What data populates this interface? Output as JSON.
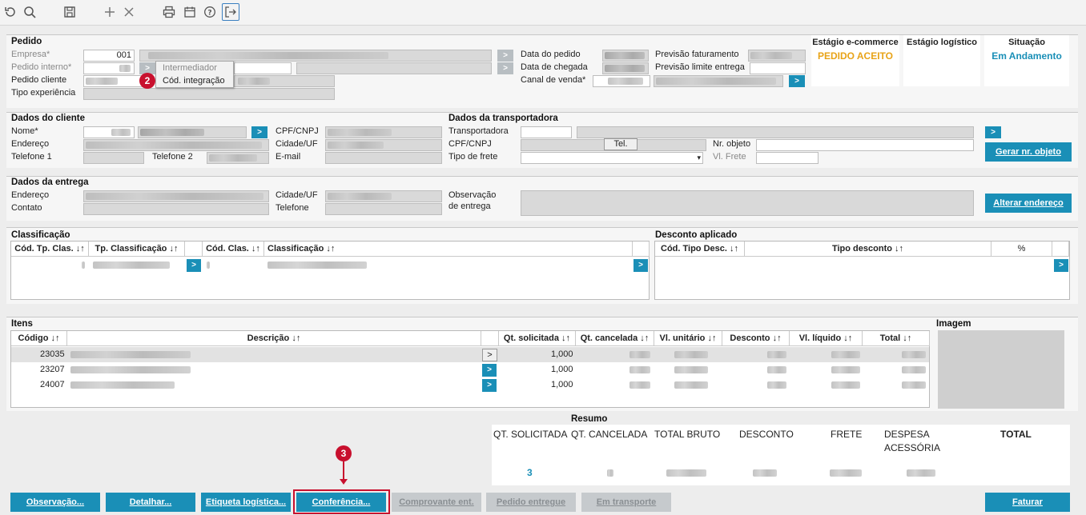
{
  "toolbar": {
    "icons": [
      "refresh-icon",
      "search-icon",
      "save-icon",
      "add-icon",
      "close-icon",
      "print-icon",
      "calendar-icon",
      "help-icon",
      "exit-icon"
    ]
  },
  "pedido": {
    "section_title": "Pedido",
    "empresa_label": "Empresa*",
    "empresa_value": "001",
    "pedido_interno_label": "Pedido interno*",
    "pedido_cliente_label": "Pedido cliente",
    "tipo_experiencia_label": "Tipo experiência",
    "data_pedido_label": "Data do pedido",
    "data_chegada_label": "Data de chegada",
    "canal_venda_label": "Canal de venda*",
    "previsao_faturamento_label": "Previsão faturamento",
    "previsao_limite_label": "Previsão limite entrega",
    "popup_items": [
      "Intermediador",
      "Cód. integração"
    ],
    "arrow_symbol": ">"
  },
  "stages": {
    "ecommerce_title": "Estágio e-commerce",
    "ecommerce_value": "PEDIDO ACEITO",
    "logistico_title": "Estágio logístico",
    "situacao_title": "Situação",
    "situacao_value": "Em Andamento",
    "ecommerce_color": "#e8a317",
    "situacao_color": "#1a8fb7"
  },
  "cliente": {
    "section_title": "Dados do cliente",
    "nome_label": "Nome*",
    "endereco_label": "Endereço",
    "telefone1_label": "Telefone 1",
    "telefone2_label": "Telefone 2",
    "cpf_label": "CPF/CNPJ",
    "cidade_label": "Cidade/UF",
    "email_label": "E-mail"
  },
  "transportadora": {
    "section_title": "Dados da transportadora",
    "transportadora_label": "Transportadora",
    "cpf_label": "CPF/CNPJ",
    "tipo_frete_label": "Tipo de frete",
    "tel_button": "Tel.",
    "nr_objeto_label": "Nr. objeto",
    "vl_frete_label": "Vl. Frete",
    "gerar_button": "Gerar nr. objeto"
  },
  "entrega": {
    "section_title": "Dados da entrega",
    "endereco_label": "Endereço",
    "contato_label": "Contato",
    "cidade_label": "Cidade/UF",
    "telefone_label": "Telefone",
    "observacao_label_1": "Observação",
    "observacao_label_2": "de entrega",
    "alterar_button": "Alterar endereço"
  },
  "classificacao": {
    "section_title": "Classificação",
    "columns": [
      "Cód. Tp. Clas. ↓↑",
      "Tp. Classificação ↓↑",
      "Cód. Clas. ↓↑",
      "Classificação ↓↑"
    ]
  },
  "desconto": {
    "section_title": "Desconto aplicado",
    "columns": [
      "Cód. Tipo Desc. ↓↑",
      "Tipo desconto ↓↑",
      "%"
    ]
  },
  "itens": {
    "section_title": "Itens",
    "columns": [
      "Código ↓↑",
      "Descrição ↓↑",
      "Qt. solicitada ↓↑",
      "Qt. cancelada ↓↑",
      "Vl. unitário ↓↑",
      "Desconto ↓↑",
      "Vl. líquido ↓↑",
      "Total ↓↑"
    ],
    "rows": [
      {
        "codigo": "23035",
        "qt_solicitada": "1,000"
      },
      {
        "codigo": "23207",
        "qt_solicitada": "1,000"
      },
      {
        "codigo": "24007",
        "qt_solicitada": "1,000"
      }
    ]
  },
  "imagem": {
    "section_title": "Imagem"
  },
  "resumo": {
    "section_title": "Resumo",
    "qt_solicitada_label": "QT. SOLICITADA",
    "qt_cancelada_label": "QT. CANCELADA",
    "total_bruto_label": "TOTAL BRUTO",
    "desconto_label": "DESCONTO",
    "frete_label": "FRETE",
    "despesa_label_1": "DESPESA",
    "despesa_label_2": "ACESSÓRIA",
    "total_label": "TOTAL",
    "qt_solicitada_value": "3"
  },
  "annotations": {
    "badge_2": "2",
    "badge_3": "3"
  },
  "buttons": {
    "observacao": "Observação...",
    "detalhar": "Detalhar...",
    "etiqueta": "Etiqueta logística...",
    "conferencia": "Conferência...",
    "comprovante": "Comprovante ent.",
    "pedido_entregue": "Pedido entregue",
    "em_transporte": "Em transporte",
    "faturar": "Faturar"
  }
}
